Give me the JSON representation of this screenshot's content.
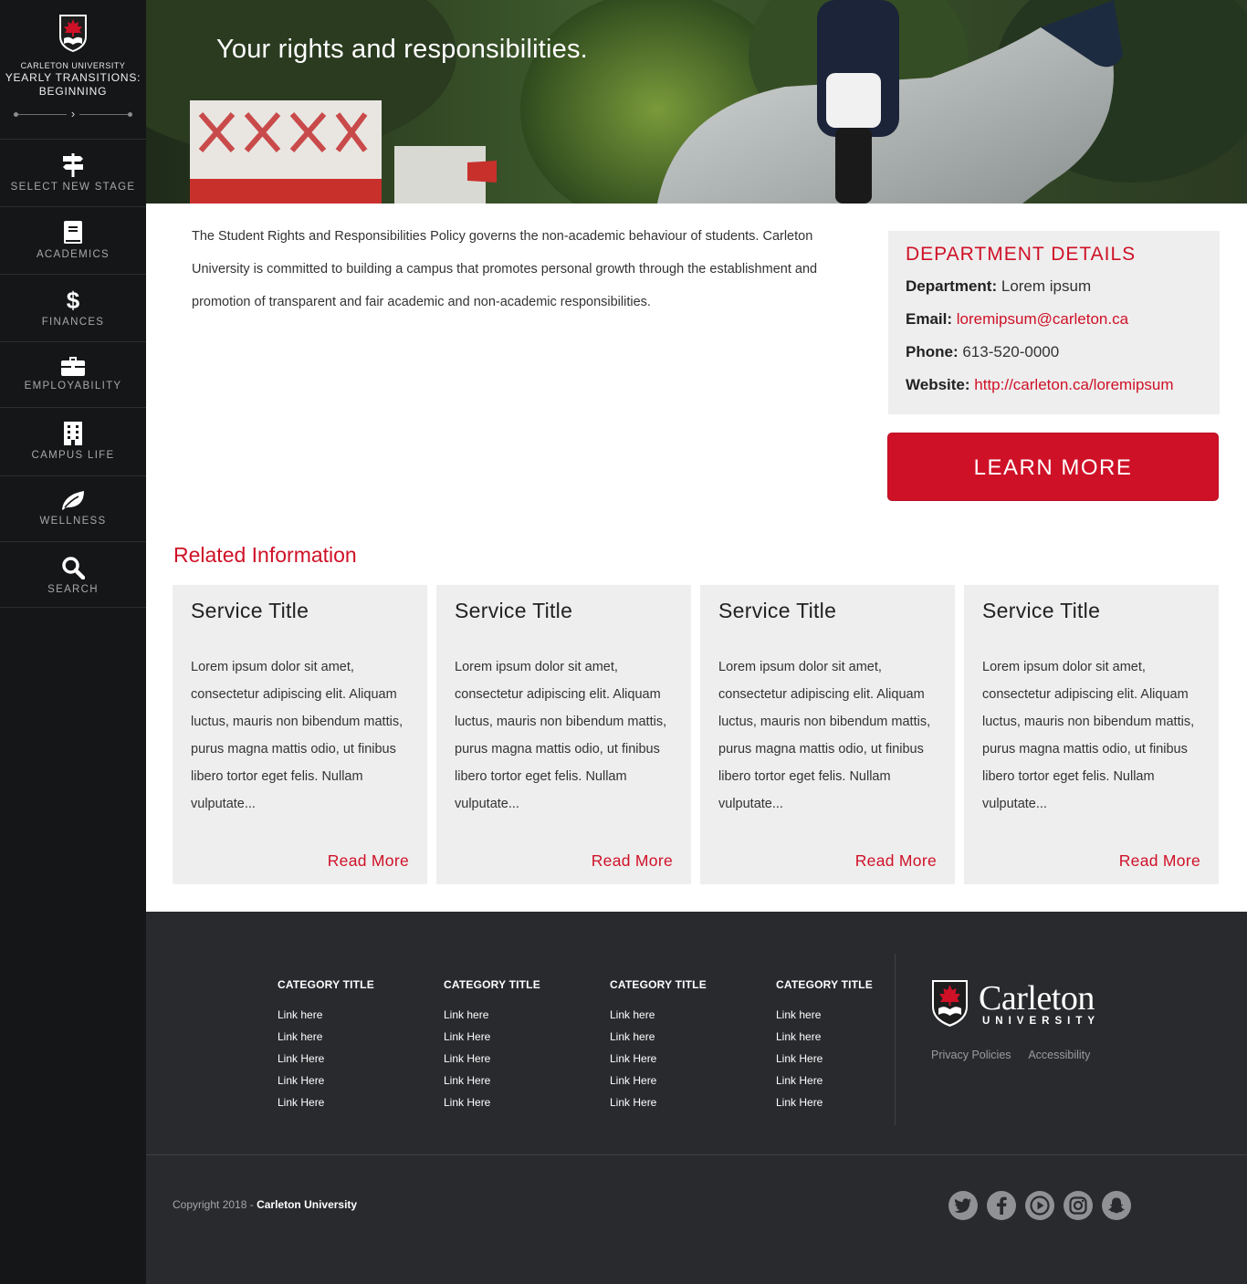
{
  "sidebar": {
    "university": "CARLETON UNIVERSITY",
    "program_line1": "YEARLY TRANSITIONS:",
    "program_line2": "BEGINNING",
    "items": [
      {
        "label": "SELECT NEW STAGE",
        "icon": "signpost-icon"
      },
      {
        "label": "ACADEMICS",
        "icon": "book-icon"
      },
      {
        "label": "FINANCES",
        "icon": "dollar-icon"
      },
      {
        "label": "EMPLOYABILITY",
        "icon": "briefcase-icon"
      },
      {
        "label": "CAMPUS LIFE",
        "icon": "building-icon"
      },
      {
        "label": "WELLNESS",
        "icon": "leaf-icon"
      },
      {
        "label": "SEARCH",
        "icon": "search-icon"
      }
    ]
  },
  "hero": {
    "title": "Your rights and responsibilities."
  },
  "intro": {
    "text": "The Student Rights and Responsibilities Policy governs the non-academic behaviour of students. Carleton University is committed to building a campus that promotes personal growth through the establishment and promotion of transparent and fair academic and non-academic responsibilities."
  },
  "department": {
    "heading": "DEPARTMENT DETAILS",
    "dept_label": "Department:",
    "dept_value": "Lorem ipsum",
    "email_label": "Email:",
    "email_value": "loremipsum@carleton.ca",
    "phone_label": "Phone:",
    "phone_value": "613-520-0000",
    "website_label": "Website:",
    "website_value": "http://carleton.ca/loremipsum"
  },
  "learn_more": "LEARN MORE",
  "related": {
    "title": "Related Information",
    "cards": [
      {
        "title": "Service Title",
        "body": "Lorem ipsum dolor sit amet, consectetur adipiscing elit. Aliquam luctus, mauris non bibendum mattis, purus magna mattis odio, ut finibus libero tortor eget felis. Nullam vulputate...",
        "link": "Read More"
      },
      {
        "title": "Service Title",
        "body": "Lorem ipsum dolor sit amet, consectetur adipiscing elit. Aliquam luctus, mauris non bibendum mattis, purus magna mattis odio, ut finibus libero tortor eget felis. Nullam vulputate...",
        "link": "Read More"
      },
      {
        "title": "Service Title",
        "body": "Lorem ipsum dolor sit amet, consectetur adipiscing elit. Aliquam luctus, mauris non bibendum mattis, purus magna mattis odio, ut finibus libero tortor eget felis. Nullam vulputate...",
        "link": "Read More"
      },
      {
        "title": "Service Title",
        "body": "Lorem ipsum dolor sit amet, consectetur adipiscing elit. Aliquam luctus, mauris non bibendum mattis, purus magna mattis odio, ut finibus libero tortor eget felis. Nullam vulputate...",
        "link": "Read More"
      }
    ]
  },
  "footer": {
    "columns": [
      {
        "title": "CATEGORY TITLE",
        "links": [
          "Link here",
          "Link here",
          "Link Here",
          "Link Here",
          "Link Here"
        ]
      },
      {
        "title": "CATEGORY TITLE",
        "links": [
          "Link here",
          "Link Here",
          "Link Here",
          "Link Here",
          "Link Here"
        ]
      },
      {
        "title": "CATEGORY TITLE",
        "links": [
          "Link here",
          "Link here",
          "Link Here",
          "Link Here",
          "Link Here"
        ]
      },
      {
        "title": "CATEGORY TITLE",
        "links": [
          "Link here",
          "Link here",
          "Link Here",
          "Link Here",
          "Link Here"
        ]
      }
    ],
    "logo_name": "Carleton",
    "logo_sub": "UNIVERSITY",
    "privacy": "Privacy Policies",
    "accessibility": "Accessibility",
    "copyright": "Copyright 2018 - ",
    "copyright_org": "Carleton University",
    "social": [
      "twitter-icon",
      "facebook-icon",
      "youtube-icon",
      "instagram-icon",
      "snapchat-icon"
    ]
  },
  "colors": {
    "accent": "#cf1127",
    "sidebar": "#151617",
    "footer": "#282a2d",
    "panel": "#eeeeee"
  }
}
